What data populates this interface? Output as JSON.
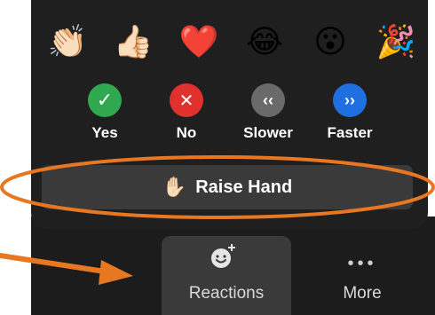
{
  "reactions_popup": {
    "emojis": [
      "👏🏻",
      "👍🏻",
      "❤️",
      "😂",
      "😮",
      "🎉"
    ],
    "feedback": [
      {
        "label": "Yes",
        "glyph": "✓",
        "color": "#2fa84f",
        "icon": "check-icon"
      },
      {
        "label": "No",
        "glyph": "✕",
        "color": "#e0312e",
        "icon": "x-icon"
      },
      {
        "label": "Slower",
        "glyph": "‹‹",
        "color": "#6a6a6a",
        "icon": "slower-icon"
      },
      {
        "label": "Faster",
        "glyph": "››",
        "color": "#1f6fe0",
        "icon": "faster-icon"
      }
    ],
    "raise_hand": {
      "icon": "✋🏻",
      "label": "Raise Hand"
    }
  },
  "toolbar": {
    "reactions_label": "Reactions",
    "more_dots": "•••",
    "more_label": "More"
  },
  "annotation": {
    "color": "#e87722"
  }
}
